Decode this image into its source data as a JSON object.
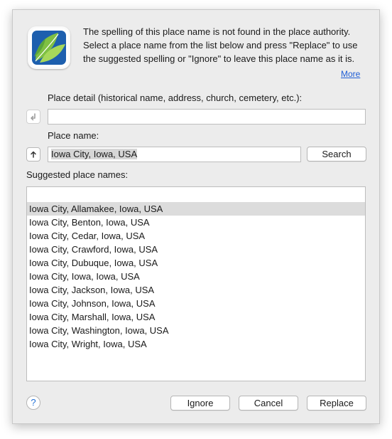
{
  "dialog": {
    "message": "The spelling of this place name is not found in the place authority. Select a place name from the list below and press \"Replace\" to use the suggested spelling or \"Ignore\" to leave this place name as it is.",
    "more_link": "More",
    "place_detail": {
      "label": "Place detail (historical name, address, church, cemetery, etc.):",
      "value": ""
    },
    "place_name": {
      "label": "Place name:",
      "value": "Iowa City, Iowa, USA"
    },
    "search_button": "Search",
    "suggested_label": "Suggested place names:",
    "suggestions": [
      "Iowa City, Allamakee, Iowa, USA",
      "Iowa City, Benton, Iowa, USA",
      "Iowa City, Cedar, Iowa, USA",
      "Iowa City, Crawford, Iowa, USA",
      "Iowa City, Dubuque, Iowa, USA",
      "Iowa City, Iowa, Iowa, USA",
      "Iowa City, Jackson, Iowa, USA",
      "Iowa City, Johnson, Iowa, USA",
      "Iowa City, Marshall, Iowa, USA",
      "Iowa City, Washington, Iowa, USA",
      "Iowa City, Wright, Iowa, USA"
    ],
    "selected_index": 0,
    "help_button": "?",
    "buttons": {
      "ignore": "Ignore",
      "cancel": "Cancel",
      "replace": "Replace"
    },
    "icons": {
      "app": "leaf-logo-icon",
      "move_down": "arrow-down-left-icon",
      "move_up": "arrow-up-icon"
    }
  }
}
